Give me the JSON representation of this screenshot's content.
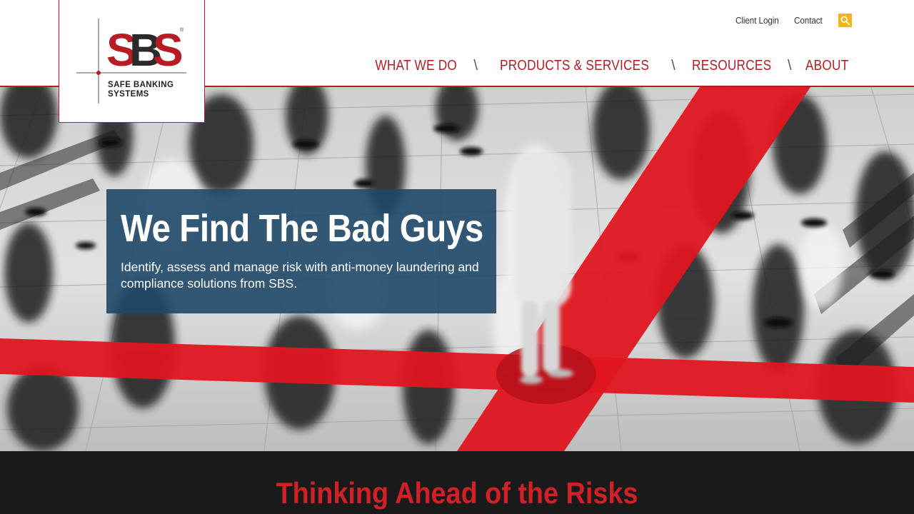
{
  "brand": {
    "logo_mark": "SBS",
    "name_line1": "SAFE BANKING",
    "name_line2": "SYSTEMS",
    "colors": {
      "red": "#b71c23",
      "dark": "#2b2b2b",
      "accent_yellow": "#f2b51d",
      "navy": "#1e4868"
    }
  },
  "utility_nav": {
    "client_login": "Client Login",
    "contact": "Contact",
    "search_icon": "search-icon"
  },
  "main_nav": {
    "items": [
      {
        "label": "WHAT WE DO"
      },
      {
        "label": "PRODUCTS & SERVICES"
      },
      {
        "label": "RESOURCES"
      },
      {
        "label": "ABOUT"
      }
    ],
    "separator": "\\"
  },
  "hero": {
    "title": "We Find The Bad Guys",
    "subtitle": "Identify, assess and manage risk with anti-money laundering and compliance solutions from SBS."
  },
  "band": {
    "title": "Thinking Ahead of the Risks"
  }
}
